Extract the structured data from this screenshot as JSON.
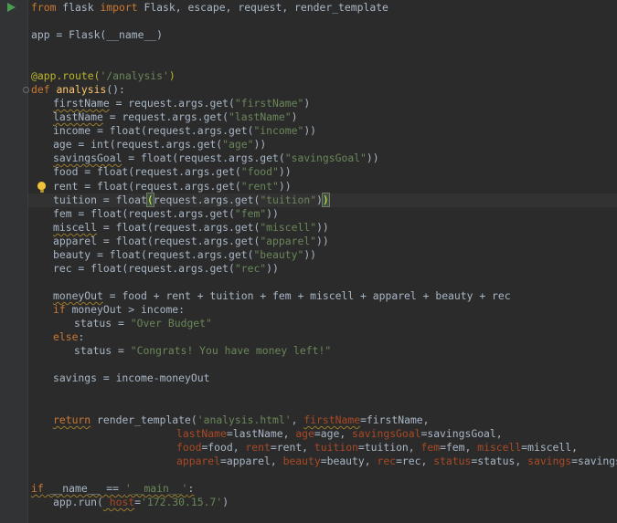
{
  "editor": {
    "gutter_icons": [
      "run-icon",
      "fold-icon",
      "lightbulb-icon"
    ],
    "colors": {
      "background": "#2b2b2b",
      "keyword": "#cc7832",
      "string": "#6a8759",
      "function": "#ffc66d",
      "decorator": "#bbb529",
      "default": "#a9b7c6"
    },
    "lines": {
      "l1": {
        "a": "from",
        "b": " flask ",
        "c": "import",
        "d": " Flask, escape, request, render_template"
      },
      "l2": {
        "a": "app = Flask(__name__)"
      },
      "l3": {
        "a": "@app.route(",
        "b": "'/analysis'",
        "c": ")"
      },
      "l4": {
        "a": "def",
        "b": " ",
        "c": "analysis",
        "d": "():"
      },
      "l5": {
        "a": "firstName",
        "b": " = request.args.get(",
        "c": "\"firstName\"",
        "d": ")"
      },
      "l6": {
        "a": "lastName",
        "b": " = request.args.get(",
        "c": "\"lastName\"",
        "d": ")"
      },
      "l7": {
        "a": "income = float(request.args.get(",
        "b": "\"income\"",
        "c": "))"
      },
      "l8": {
        "a": "age = int(request.args.get(",
        "b": "\"age\"",
        "c": "))"
      },
      "l9": {
        "a": "savingsGoal",
        "b": " = float(request.args.get(",
        "c": "\"savingsGoal\"",
        "d": "))"
      },
      "l10": {
        "a": "food = float(request.args.get(",
        "b": "\"food\"",
        "c": "))"
      },
      "l11": {
        "a": "rent = float(request.args.get(",
        "b": "\"rent\"",
        "c": "))"
      },
      "l12": {
        "a": "tuition = float",
        "b": "(",
        "c": "request.args.get(",
        "d": "\"tuition\"",
        "e": ")",
        "f": ")"
      },
      "l13": {
        "a": "fem = float(request.args.get(",
        "b": "\"fem\"",
        "c": "))"
      },
      "l14": {
        "a": "miscell",
        "b": " = float(request.args.get(",
        "c": "\"miscell\"",
        "d": "))"
      },
      "l15": {
        "a": "apparel = float(request.args.get(",
        "b": "\"apparel\"",
        "c": "))"
      },
      "l16": {
        "a": "beauty = float(request.args.get(",
        "b": "\"beauty\"",
        "c": "))"
      },
      "l17": {
        "a": "rec = float(request.args.get(",
        "b": "\"rec\"",
        "c": "))"
      },
      "l18": {
        "a": "moneyOut",
        "b": " = food + rent + tuition + fem + miscell + apparel + beauty + rec"
      },
      "l19": {
        "a": "if",
        "b": " moneyOut > income:"
      },
      "l20": {
        "a": "status = ",
        "b": "\"Over Budget\""
      },
      "l21": {
        "a": "else",
        "b": ":"
      },
      "l22": {
        "a": "status = ",
        "b": "\"Congrats! You have money left!\""
      },
      "l23": {
        "a": "savings = income-moneyOut"
      },
      "l24": {
        "a": "return",
        "b": " render_template(",
        "c": "'analysis.html'",
        "d": ", ",
        "e": "firstName",
        "f": "=firstName,"
      },
      "l25": {
        "a": "lastName",
        "b": "=lastName, ",
        "c": "age",
        "d": "=age, ",
        "e": "savingsGoal",
        "f": "=savingsGoal,"
      },
      "l26": {
        "a": "food",
        "b": "=food, ",
        "c": "rent",
        "d": "=rent, ",
        "e": "tuition",
        "f": "=tuition, ",
        "g": "fem",
        "h": "=fem, ",
        "i": "miscell",
        "j": "=miscell,"
      },
      "l27": {
        "a": "apparel",
        "b": "=apparel, ",
        "c": "beauty",
        "d": "=beauty, ",
        "e": "rec",
        "f": "=rec, ",
        "g": "status",
        "h": "=status, ",
        "i": "savings",
        "j": "=savings)"
      },
      "l28": {
        "a": "if",
        "b": " __name__ == ",
        "c": "'__main__'",
        "d": ":"
      },
      "l29": {
        "a": "app.run(",
        "b": " host",
        "c": "=",
        "d": "'172.30.15.7'",
        "e": ")"
      }
    }
  }
}
